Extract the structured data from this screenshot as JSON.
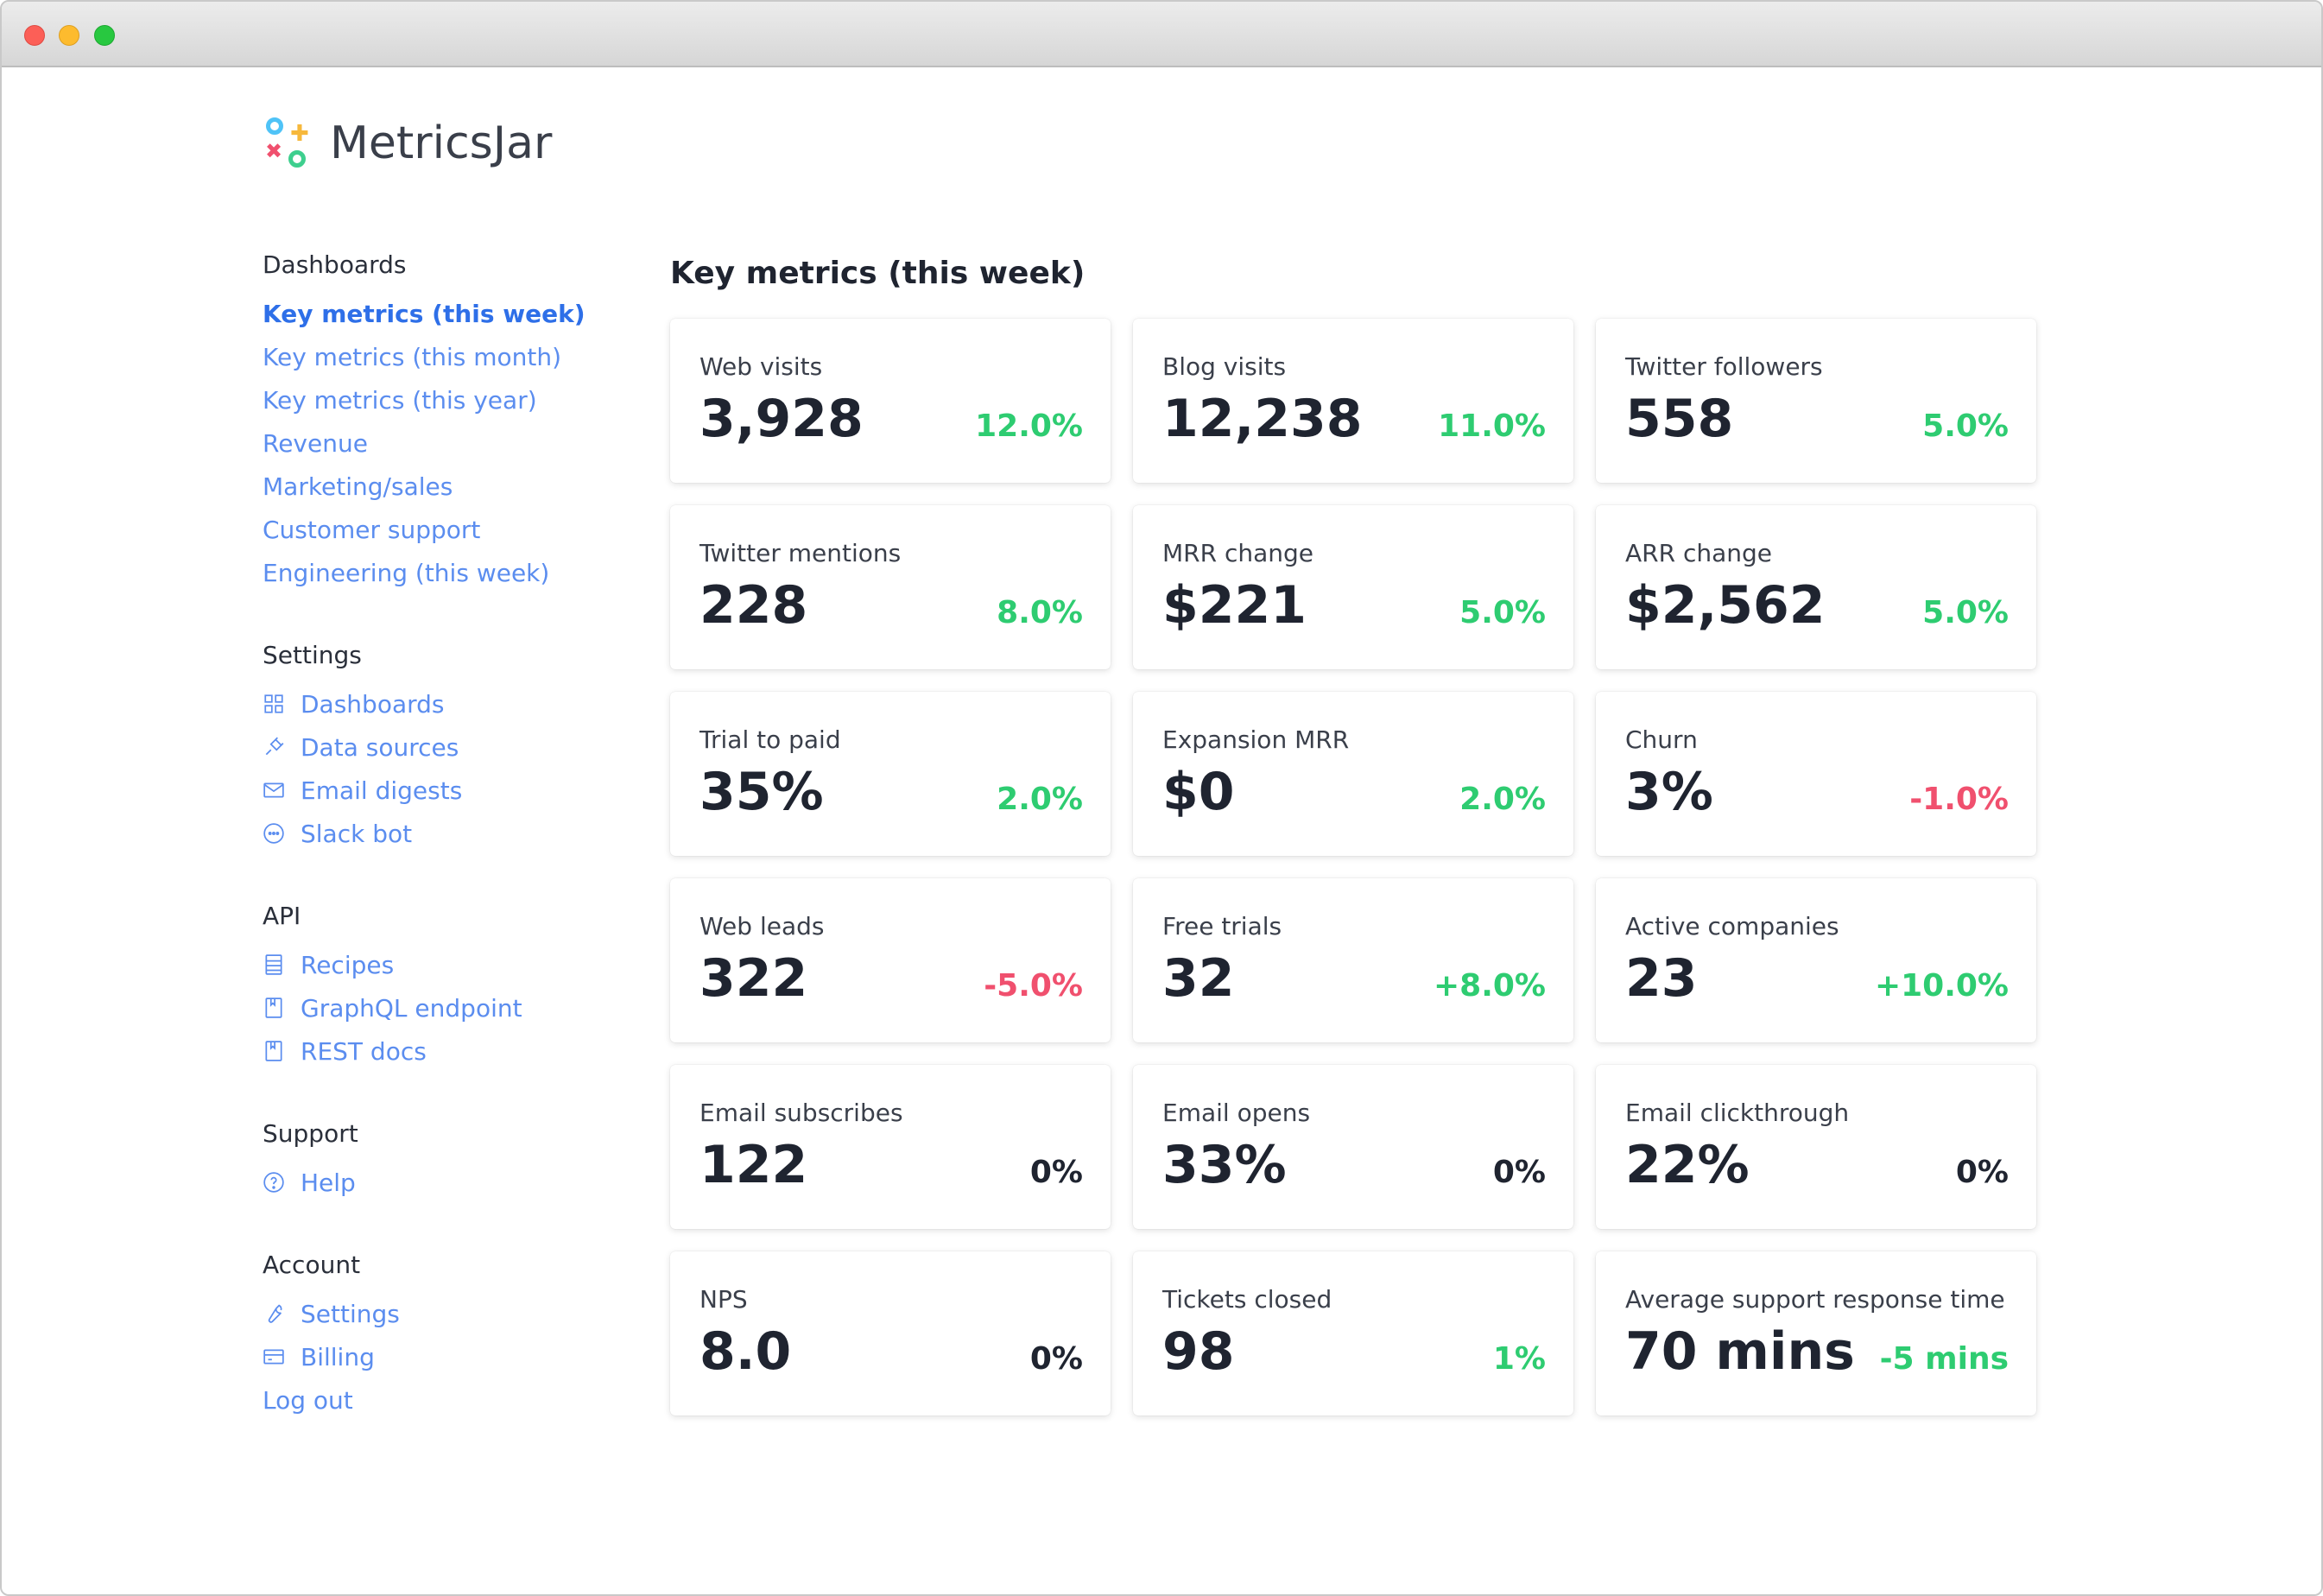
{
  "app": {
    "brand_name": "MetricsJar"
  },
  "sidebar": {
    "sections": [
      {
        "heading": "Dashboards",
        "items": [
          {
            "label": "Key metrics (this week)",
            "active": true,
            "icon": ""
          },
          {
            "label": "Key metrics (this month)",
            "active": false,
            "icon": ""
          },
          {
            "label": "Key metrics (this year)",
            "active": false,
            "icon": ""
          },
          {
            "label": "Revenue",
            "active": false,
            "icon": ""
          },
          {
            "label": "Marketing/sales",
            "active": false,
            "icon": ""
          },
          {
            "label": "Customer support",
            "active": false,
            "icon": ""
          },
          {
            "label": "Engineering (this week)",
            "active": false,
            "icon": ""
          }
        ]
      },
      {
        "heading": "Settings",
        "items": [
          {
            "label": "Dashboards",
            "active": false,
            "icon": "grid-icon"
          },
          {
            "label": "Data sources",
            "active": false,
            "icon": "plug-icon"
          },
          {
            "label": "Email digests",
            "active": false,
            "icon": "mail-icon"
          },
          {
            "label": "Slack bot",
            "active": false,
            "icon": "chat-icon"
          }
        ]
      },
      {
        "heading": "API",
        "items": [
          {
            "label": "Recipes",
            "active": false,
            "icon": "recipe-icon"
          },
          {
            "label": "GraphQL endpoint",
            "active": false,
            "icon": "book-icon"
          },
          {
            "label": "REST docs",
            "active": false,
            "icon": "book-icon"
          }
        ]
      },
      {
        "heading": "Support",
        "items": [
          {
            "label": "Help",
            "active": false,
            "icon": "help-icon"
          }
        ]
      },
      {
        "heading": "Account",
        "items": [
          {
            "label": "Settings",
            "active": false,
            "icon": "wrench-icon"
          },
          {
            "label": "Billing",
            "active": false,
            "icon": "card-icon"
          },
          {
            "label": "Log out",
            "active": false,
            "icon": ""
          }
        ]
      }
    ]
  },
  "main": {
    "title": "Key metrics (this week)",
    "cards": [
      {
        "label": "Web visits",
        "value": "3,928",
        "change": "12.0%",
        "trend": "up"
      },
      {
        "label": "Blog visits",
        "value": "12,238",
        "change": "11.0%",
        "trend": "up"
      },
      {
        "label": "Twitter followers",
        "value": "558",
        "change": "5.0%",
        "trend": "up"
      },
      {
        "label": "Twitter mentions",
        "value": "228",
        "change": "8.0%",
        "trend": "up"
      },
      {
        "label": "MRR change",
        "value": "$221",
        "change": "5.0%",
        "trend": "up"
      },
      {
        "label": "ARR change",
        "value": "$2,562",
        "change": "5.0%",
        "trend": "up"
      },
      {
        "label": "Trial to paid",
        "value": "35%",
        "change": "2.0%",
        "trend": "up"
      },
      {
        "label": "Expansion MRR",
        "value": "$0",
        "change": "2.0%",
        "trend": "up"
      },
      {
        "label": "Churn",
        "value": "3%",
        "change": "-1.0%",
        "trend": "down"
      },
      {
        "label": "Web leads",
        "value": "322",
        "change": "-5.0%",
        "trend": "down"
      },
      {
        "label": "Free trials",
        "value": "32",
        "change": "+8.0%",
        "trend": "up"
      },
      {
        "label": "Active companies",
        "value": "23",
        "change": "+10.0%",
        "trend": "up"
      },
      {
        "label": "Email subscribes",
        "value": "122",
        "change": "0%",
        "trend": "flat"
      },
      {
        "label": "Email opens",
        "value": "33%",
        "change": "0%",
        "trend": "flat"
      },
      {
        "label": "Email clickthrough",
        "value": "22%",
        "change": "0%",
        "trend": "flat"
      },
      {
        "label": "NPS",
        "value": "8.0",
        "change": "0%",
        "trend": "flat"
      },
      {
        "label": "Tickets closed",
        "value": "98",
        "change": "1%",
        "trend": "up"
      },
      {
        "label": "Average support response time",
        "value": "70 mins",
        "change": "-5 mins",
        "trend": "up"
      }
    ]
  },
  "colors": {
    "link": "#5b8def",
    "active_link": "#2e6fe8",
    "positive": "#2ecc71",
    "negative": "#f0506e",
    "neutral": "#1f2430"
  }
}
